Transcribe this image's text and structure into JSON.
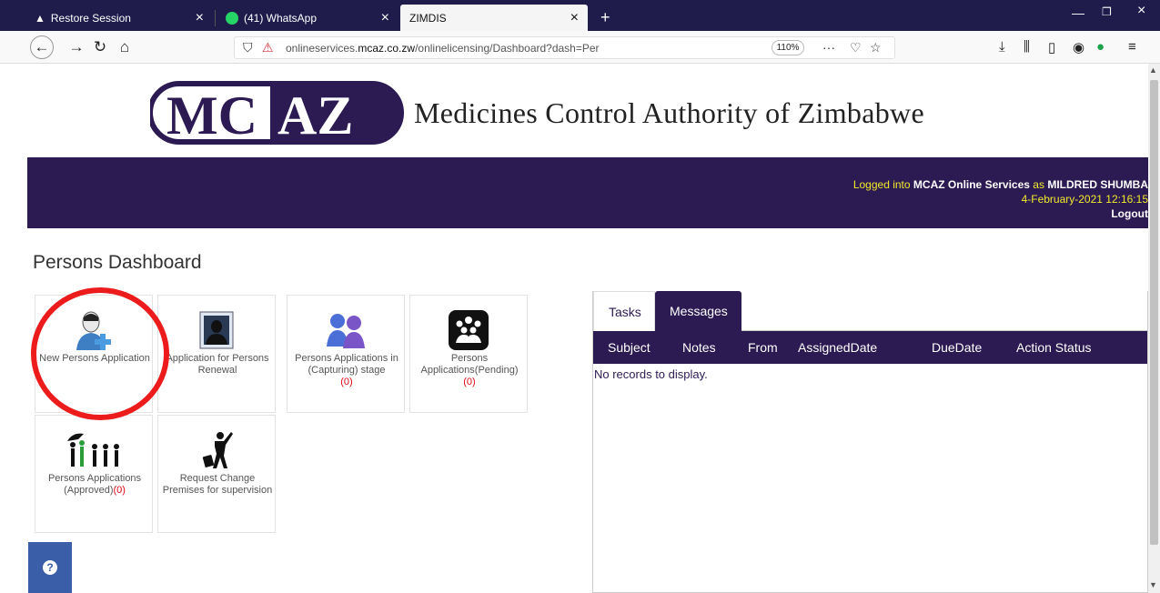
{
  "browser": {
    "tabs": [
      {
        "label": "Restore Session",
        "icon": "warning-icon"
      },
      {
        "label": "(41) WhatsApp",
        "icon": "whatsapp-icon"
      },
      {
        "label": "ZIMDIS",
        "icon": ""
      }
    ],
    "url_prefix": "onlineservices.",
    "url_domain": "mcaz.co.zw",
    "url_path": "/onlinelicensing/Dashboard?dash=Per",
    "zoom": "110%",
    "new_tab": "+",
    "close": "×",
    "more": "···"
  },
  "header": {
    "logo_text": "MCAZ",
    "org_name": "Medicines Control Authority of Zimbabwe",
    "login_prefix": "Logged into",
    "service": "MCAZ Online Services",
    "login_as": "as",
    "user": "MILDRED SHUMBA",
    "datetime": "4-February-2021 12:16:15",
    "logout": "Logout"
  },
  "page": {
    "title": "Persons Dashboard"
  },
  "tiles": [
    {
      "label": "New Persons Application",
      "count": ""
    },
    {
      "label": "Application for Persons Renewal",
      "count": ""
    },
    {
      "label": "Persons Applications in (Capturing) stage",
      "count": "(0)"
    },
    {
      "label": "Persons Applications(Pending)",
      "count": "(0)"
    },
    {
      "label": "Persons Applications (Approved)",
      "count": "(0)"
    },
    {
      "label": "Request Change Premises for supervision",
      "count": ""
    }
  ],
  "panel": {
    "tabs": [
      "Tasks",
      "Messages"
    ],
    "columns": [
      "Subject",
      "Notes",
      "From",
      "AssignedDate",
      "DueDate",
      "Action Status"
    ],
    "empty": "No records to display."
  },
  "help": "?",
  "colors": {
    "brand_purple": "#2c1a52",
    "highlight_red": "#ec1c1c",
    "count_red": "#e30613"
  }
}
